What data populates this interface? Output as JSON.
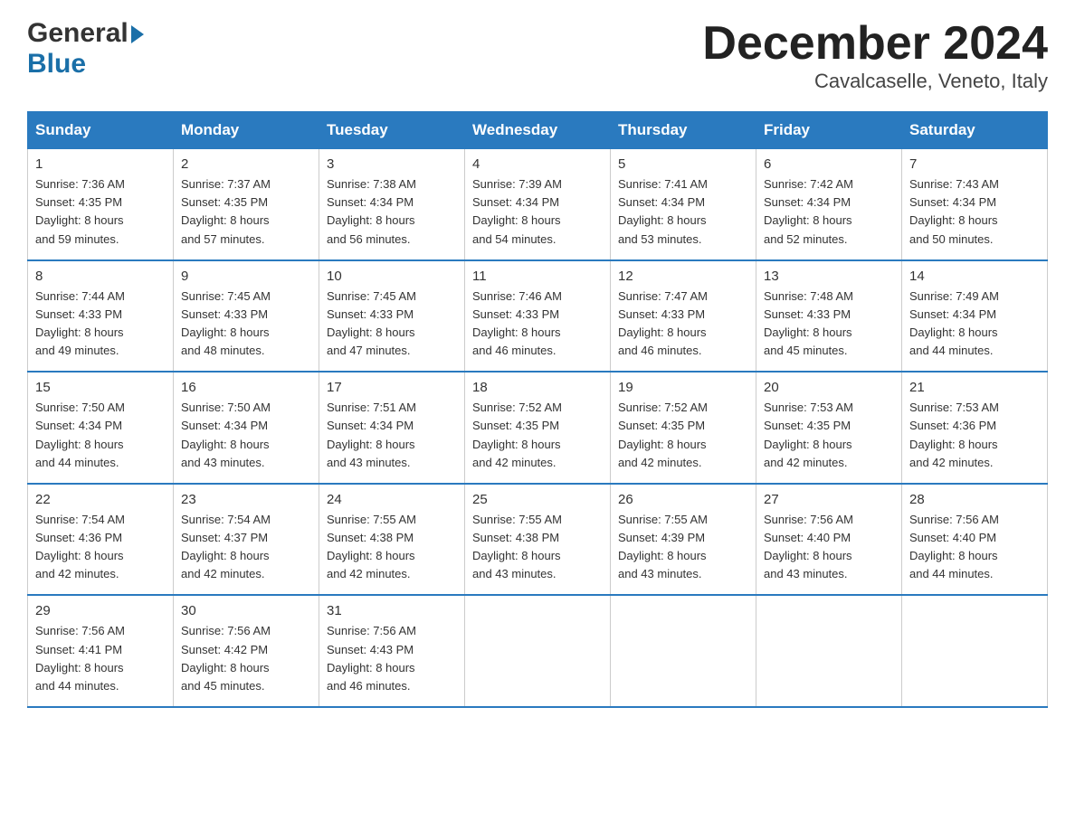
{
  "header": {
    "title": "December 2024",
    "subtitle": "Cavalcaselle, Veneto, Italy",
    "logo_general": "General",
    "logo_blue": "Blue"
  },
  "weekdays": [
    "Sunday",
    "Monday",
    "Tuesday",
    "Wednesday",
    "Thursday",
    "Friday",
    "Saturday"
  ],
  "weeks": [
    [
      {
        "day": "1",
        "sunrise": "7:36 AM",
        "sunset": "4:35 PM",
        "daylight": "8 hours and 59 minutes."
      },
      {
        "day": "2",
        "sunrise": "7:37 AM",
        "sunset": "4:35 PM",
        "daylight": "8 hours and 57 minutes."
      },
      {
        "day": "3",
        "sunrise": "7:38 AM",
        "sunset": "4:34 PM",
        "daylight": "8 hours and 56 minutes."
      },
      {
        "day": "4",
        "sunrise": "7:39 AM",
        "sunset": "4:34 PM",
        "daylight": "8 hours and 54 minutes."
      },
      {
        "day": "5",
        "sunrise": "7:41 AM",
        "sunset": "4:34 PM",
        "daylight": "8 hours and 53 minutes."
      },
      {
        "day": "6",
        "sunrise": "7:42 AM",
        "sunset": "4:34 PM",
        "daylight": "8 hours and 52 minutes."
      },
      {
        "day": "7",
        "sunrise": "7:43 AM",
        "sunset": "4:34 PM",
        "daylight": "8 hours and 50 minutes."
      }
    ],
    [
      {
        "day": "8",
        "sunrise": "7:44 AM",
        "sunset": "4:33 PM",
        "daylight": "8 hours and 49 minutes."
      },
      {
        "day": "9",
        "sunrise": "7:45 AM",
        "sunset": "4:33 PM",
        "daylight": "8 hours and 48 minutes."
      },
      {
        "day": "10",
        "sunrise": "7:45 AM",
        "sunset": "4:33 PM",
        "daylight": "8 hours and 47 minutes."
      },
      {
        "day": "11",
        "sunrise": "7:46 AM",
        "sunset": "4:33 PM",
        "daylight": "8 hours and 46 minutes."
      },
      {
        "day": "12",
        "sunrise": "7:47 AM",
        "sunset": "4:33 PM",
        "daylight": "8 hours and 46 minutes."
      },
      {
        "day": "13",
        "sunrise": "7:48 AM",
        "sunset": "4:33 PM",
        "daylight": "8 hours and 45 minutes."
      },
      {
        "day": "14",
        "sunrise": "7:49 AM",
        "sunset": "4:34 PM",
        "daylight": "8 hours and 44 minutes."
      }
    ],
    [
      {
        "day": "15",
        "sunrise": "7:50 AM",
        "sunset": "4:34 PM",
        "daylight": "8 hours and 44 minutes."
      },
      {
        "day": "16",
        "sunrise": "7:50 AM",
        "sunset": "4:34 PM",
        "daylight": "8 hours and 43 minutes."
      },
      {
        "day": "17",
        "sunrise": "7:51 AM",
        "sunset": "4:34 PM",
        "daylight": "8 hours and 43 minutes."
      },
      {
        "day": "18",
        "sunrise": "7:52 AM",
        "sunset": "4:35 PM",
        "daylight": "8 hours and 42 minutes."
      },
      {
        "day": "19",
        "sunrise": "7:52 AM",
        "sunset": "4:35 PM",
        "daylight": "8 hours and 42 minutes."
      },
      {
        "day": "20",
        "sunrise": "7:53 AM",
        "sunset": "4:35 PM",
        "daylight": "8 hours and 42 minutes."
      },
      {
        "day": "21",
        "sunrise": "7:53 AM",
        "sunset": "4:36 PM",
        "daylight": "8 hours and 42 minutes."
      }
    ],
    [
      {
        "day": "22",
        "sunrise": "7:54 AM",
        "sunset": "4:36 PM",
        "daylight": "8 hours and 42 minutes."
      },
      {
        "day": "23",
        "sunrise": "7:54 AM",
        "sunset": "4:37 PM",
        "daylight": "8 hours and 42 minutes."
      },
      {
        "day": "24",
        "sunrise": "7:55 AM",
        "sunset": "4:38 PM",
        "daylight": "8 hours and 42 minutes."
      },
      {
        "day": "25",
        "sunrise": "7:55 AM",
        "sunset": "4:38 PM",
        "daylight": "8 hours and 43 minutes."
      },
      {
        "day": "26",
        "sunrise": "7:55 AM",
        "sunset": "4:39 PM",
        "daylight": "8 hours and 43 minutes."
      },
      {
        "day": "27",
        "sunrise": "7:56 AM",
        "sunset": "4:40 PM",
        "daylight": "8 hours and 43 minutes."
      },
      {
        "day": "28",
        "sunrise": "7:56 AM",
        "sunset": "4:40 PM",
        "daylight": "8 hours and 44 minutes."
      }
    ],
    [
      {
        "day": "29",
        "sunrise": "7:56 AM",
        "sunset": "4:41 PM",
        "daylight": "8 hours and 44 minutes."
      },
      {
        "day": "30",
        "sunrise": "7:56 AM",
        "sunset": "4:42 PM",
        "daylight": "8 hours and 45 minutes."
      },
      {
        "day": "31",
        "sunrise": "7:56 AM",
        "sunset": "4:43 PM",
        "daylight": "8 hours and 46 minutes."
      },
      null,
      null,
      null,
      null
    ]
  ],
  "sunrise_label": "Sunrise:",
  "sunset_label": "Sunset:",
  "daylight_label": "Daylight:"
}
